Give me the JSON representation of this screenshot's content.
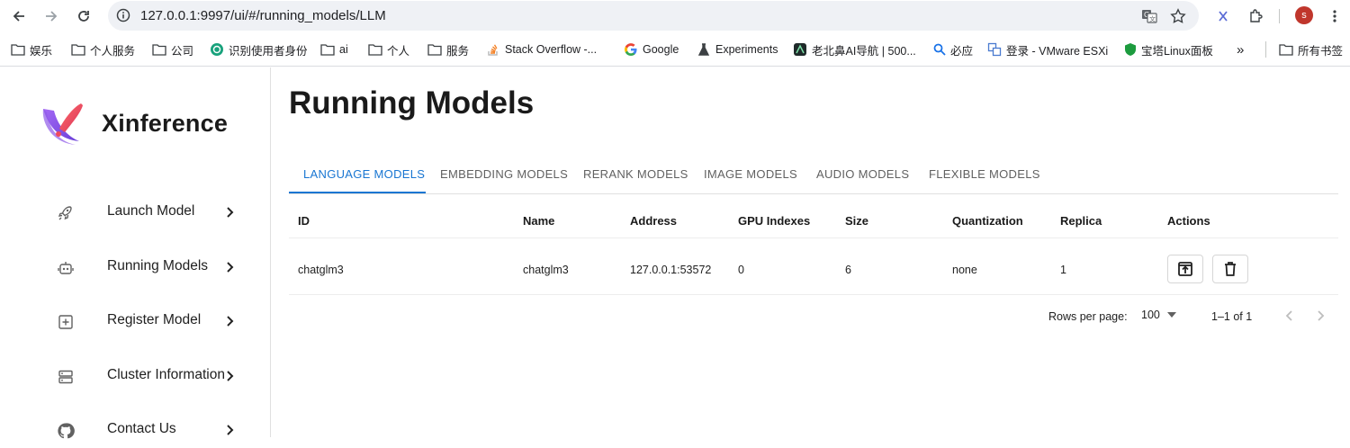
{
  "browser": {
    "url": "127.0.0.1:9997/ui/#/running_models/LLM",
    "avatar_letter": "s",
    "bookmarks": [
      {
        "label": "娱乐",
        "icon": "folder-icon"
      },
      {
        "label": "个人服务",
        "icon": "folder-icon"
      },
      {
        "label": "公司",
        "icon": "folder-icon"
      },
      {
        "label": "识别使用者身份",
        "icon": "openai-icon"
      },
      {
        "label": "ai",
        "icon": "folder-icon"
      },
      {
        "label": "个人",
        "icon": "folder-icon"
      },
      {
        "label": "服务",
        "icon": "folder-icon"
      },
      {
        "label": "Stack Overflow -...",
        "icon": "stackoverflow-icon"
      },
      {
        "label": "Google",
        "icon": "google-icon"
      },
      {
        "label": "Experiments",
        "icon": "flask-icon"
      },
      {
        "label": "老北鼻AI导航 | 500...",
        "icon": "site-icon"
      },
      {
        "label": "必应",
        "icon": "search-icon"
      },
      {
        "label": "登录 - VMware ESXi",
        "icon": "vmware-icon"
      },
      {
        "label": "宝塔Linux面板",
        "icon": "shield-icon"
      },
      {
        "label": "»",
        "icon": "more-icon"
      },
      {
        "label": "所有书签",
        "icon": "folder-icon"
      }
    ]
  },
  "app": {
    "brand": "Xinference",
    "nav": [
      {
        "label": "Launch Model",
        "icon": "rocket-icon"
      },
      {
        "label": "Running Models",
        "icon": "robot-icon"
      },
      {
        "label": "Register Model",
        "icon": "plus-box-icon"
      },
      {
        "label": "Cluster Information",
        "icon": "server-icon"
      },
      {
        "label": "Contact Us",
        "icon": "github-icon"
      }
    ],
    "page_title": "Running Models",
    "tabs": [
      "LANGUAGE MODELS",
      "EMBEDDING MODELS",
      "RERANK MODELS",
      "IMAGE MODELS",
      "AUDIO MODELS",
      "FLEXIBLE MODELS"
    ],
    "active_tab": "LANGUAGE MODELS",
    "table": {
      "headers": [
        "ID",
        "Name",
        "Address",
        "GPU Indexes",
        "Size",
        "Quantization",
        "Replica",
        "Actions"
      ],
      "rows": [
        {
          "id": "chatglm3",
          "name": "chatglm3",
          "address": "127.0.0.1:53572",
          "gpu_indexes": "0",
          "size": "6",
          "quantization": "none",
          "replica": "1",
          "actions": [
            "open-in-new-icon",
            "delete-icon"
          ]
        }
      ]
    },
    "pagination": {
      "rows_per_page_label": "Rows per page:",
      "rows_per_page": "100",
      "range": "1–1 of 1"
    }
  },
  "colors": {
    "accent": "#1976d2",
    "text": "#212121",
    "logo_purple": "#7b4ee0",
    "logo_red": "#ef4a5e"
  }
}
